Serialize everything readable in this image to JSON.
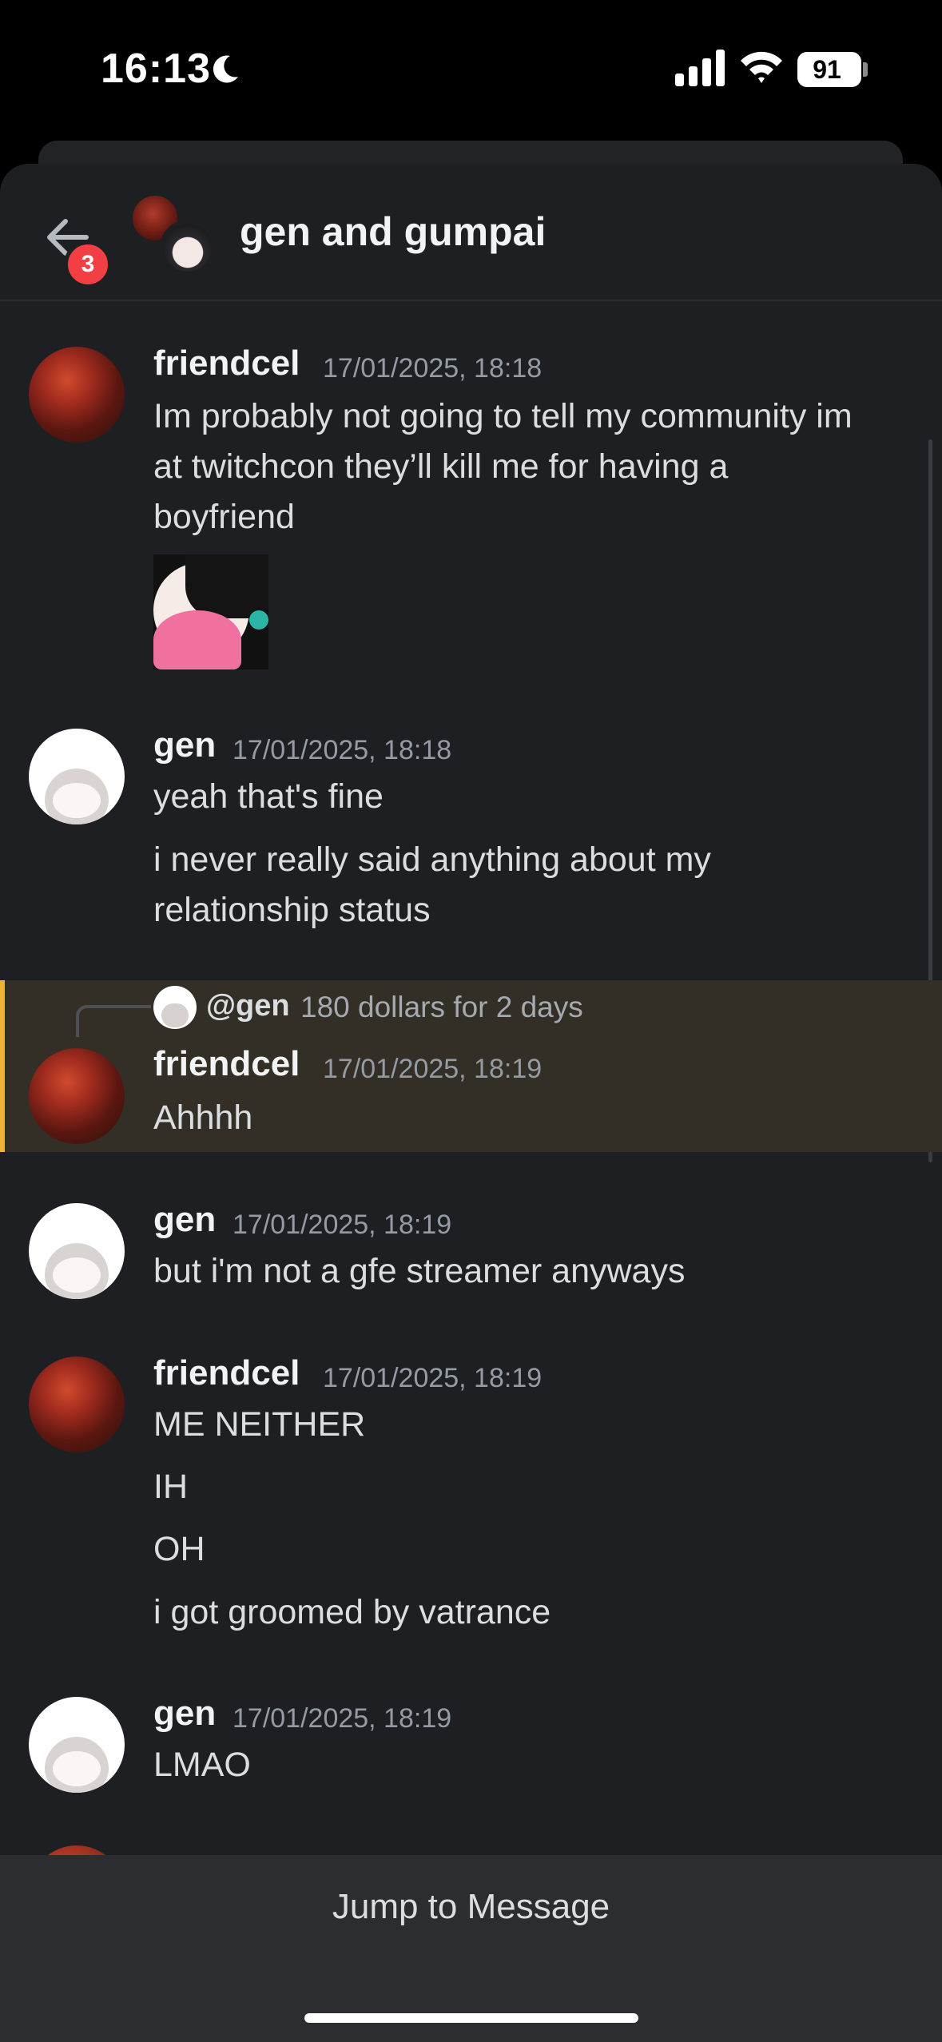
{
  "status_bar": {
    "time": "16:13",
    "battery": "91",
    "icons": [
      "moon-icon",
      "signal-icon",
      "wifi-icon",
      "battery-icon"
    ]
  },
  "header": {
    "title": "gen and gumpai",
    "back_badge": "3",
    "icons": [
      "back-arrow-icon"
    ]
  },
  "messages": [
    {
      "author": "friendcel",
      "timestamp": "17/01/2025, 18:18",
      "lines": [
        "Im probably not going to tell my community im",
        "at twitchcon they’ll kill me for having a",
        "boyfriend"
      ]
    },
    {
      "author": "gen",
      "timestamp": "17/01/2025, 18:18",
      "lines": [
        "yeah that's fine",
        "i never really said anything about my",
        "relationship status"
      ]
    },
    {
      "author": "friendcel",
      "timestamp": "17/01/2025, 18:19",
      "reply_to": "@gen",
      "reply_text": "180 dollars for 2 days",
      "lines": [
        "Ahhhh"
      ],
      "highlighted": true
    },
    {
      "author": "gen",
      "timestamp": "17/01/2025, 18:19",
      "lines": [
        "but i'm not a gfe streamer anyways"
      ]
    },
    {
      "author": "friendcel",
      "timestamp": "17/01/2025, 18:19",
      "lines": [
        "ME NEITHER",
        "IH",
        "OH",
        "i got groomed by vatrance"
      ]
    },
    {
      "author": "gen",
      "timestamp": "17/01/2025, 18:19",
      "lines": [
        "LMAO"
      ]
    }
  ],
  "footer": {
    "jump_label": "Jump to Message"
  },
  "colors": {
    "background": "#1e1f22",
    "highlight": "#332f26",
    "highlight_bar": "#f0b232",
    "badge": "#f23f43"
  }
}
